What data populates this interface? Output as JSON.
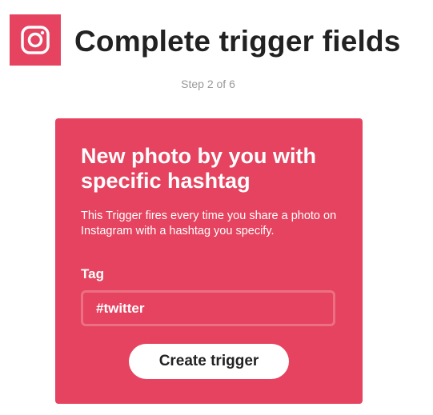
{
  "header": {
    "logo_icon": "instagram-icon",
    "title": "Complete trigger fields",
    "step": "Step 2 of 6"
  },
  "card": {
    "background_color": "#e5435f",
    "title": "New photo by you with specific hashtag",
    "description": "This Trigger fires every time you share a photo on Instagram with a hashtag you specify.",
    "tag_field": {
      "label": "Tag",
      "value": "#twitter"
    },
    "submit_label": "Create trigger"
  }
}
